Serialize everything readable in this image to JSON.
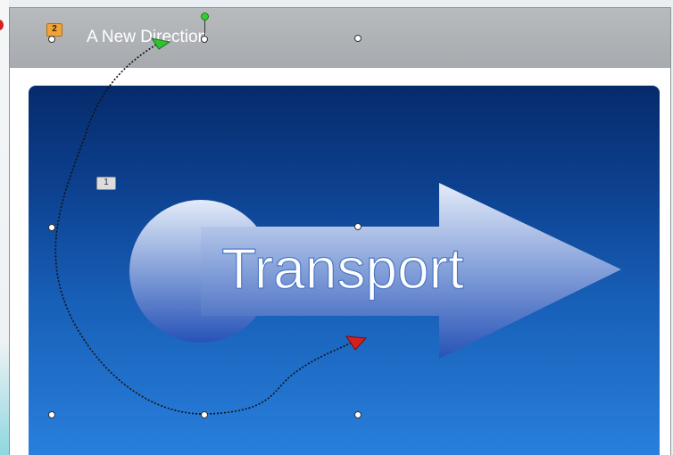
{
  "slide": {
    "title": "A New Direction",
    "graphic_text": "Transport"
  },
  "animation_badges": {
    "title_order": "2",
    "graphic_order": "1"
  },
  "colors": {
    "title_bar": "#ababaf",
    "panel_top": "#062b6b",
    "panel_bottom": "#2a83e0",
    "motion_start": "#2fc42f",
    "motion_end": "#d61f1f",
    "badge_title": "#f0a33a",
    "badge_graphic": "#dcdcdc"
  },
  "icons": {
    "motion_start": "green-triangle-icon",
    "motion_end": "red-triangle-icon",
    "rotate": "rotate-handle-icon"
  }
}
